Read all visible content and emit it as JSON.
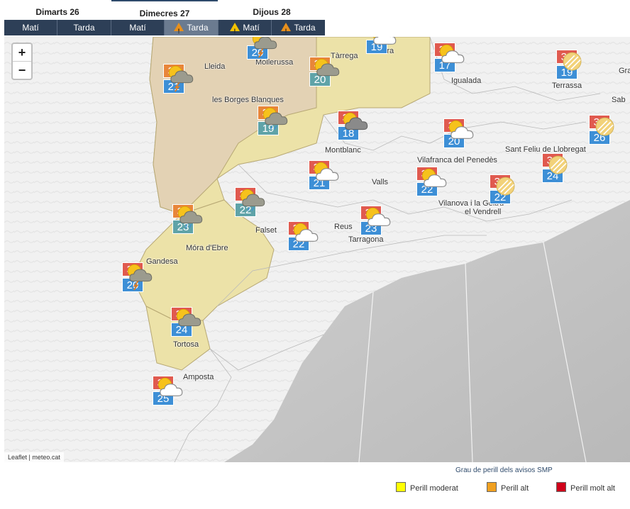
{
  "days": [
    {
      "label": "Dimarts 26"
    },
    {
      "label": "Dimecres 27"
    },
    {
      "label": "Dijous 28"
    }
  ],
  "periods": [
    {
      "label": "Matí",
      "warning": ""
    },
    {
      "label": "Tarda",
      "warning": ""
    },
    {
      "label": "Matí",
      "warning": ""
    },
    {
      "label": "Tarda",
      "warning": "orange"
    },
    {
      "label": "Matí",
      "warning": "yellow"
    },
    {
      "label": "Tarda",
      "warning": "orange"
    }
  ],
  "zoom": {
    "in": "+",
    "out": "−"
  },
  "attribution": "Leaflet | meteo.cat",
  "cities": [
    {
      "name": "Lleida"
    },
    {
      "name": "Mollerussa"
    },
    {
      "name": "Tàrrega"
    },
    {
      "name": "Cervera"
    },
    {
      "name": "Igualada"
    },
    {
      "name": "Terrassa"
    },
    {
      "name": "les Borges Blanques"
    },
    {
      "name": "Montblanc"
    },
    {
      "name": "Sant Feliu de Llobregat"
    },
    {
      "name": "Vilafranca del Penedès"
    },
    {
      "name": "Valls"
    },
    {
      "name": "Vilanova i la Geltrú"
    },
    {
      "name": "el Vendrell"
    },
    {
      "name": "Falset"
    },
    {
      "name": "Reus"
    },
    {
      "name": "Tarragona"
    },
    {
      "name": "Móra d'Ebre"
    },
    {
      "name": "Gandesa"
    },
    {
      "name": "Tortosa"
    },
    {
      "name": "Amposta"
    },
    {
      "name": "Sab"
    },
    {
      "name": "Gra"
    }
  ],
  "forecasts": [
    {
      "max": "",
      "min": "20",
      "icon": "storm"
    },
    {
      "max": "",
      "min": "19",
      "icon": "partly-cloudy"
    },
    {
      "max": "34",
      "min": "17",
      "icon": "partly-cloudy"
    },
    {
      "max": "33",
      "min": "19",
      "icon": "haze"
    },
    {
      "max": "36",
      "min": "21",
      "icon": "storm"
    },
    {
      "max": "35",
      "min": "20",
      "icon": "partly-cloudy-dark"
    },
    {
      "max": "36",
      "min": "19",
      "icon": "rain-cloud"
    },
    {
      "max": "32",
      "min": "18",
      "icon": "cloudy"
    },
    {
      "max": "33",
      "min": "20",
      "icon": "partly-cloudy"
    },
    {
      "max": "30",
      "min": "26",
      "icon": "haze"
    },
    {
      "max": "31",
      "min": "21",
      "icon": "partly-cloudy"
    },
    {
      "max": "32",
      "min": "22",
      "icon": "rain-cloud"
    },
    {
      "max": "33",
      "min": "22",
      "icon": "partly-cloudy"
    },
    {
      "max": "32",
      "min": "22",
      "icon": "haze"
    },
    {
      "max": "30",
      "min": "24",
      "icon": "haze"
    },
    {
      "max": "35",
      "min": "23",
      "icon": "rain-cloud"
    },
    {
      "max": "31",
      "min": "22",
      "icon": "partly-cloudy"
    },
    {
      "max": "30",
      "min": "23",
      "icon": "partly-cloudy"
    },
    {
      "max": "33",
      "min": "20",
      "icon": "storm"
    },
    {
      "max": "34",
      "min": "24",
      "icon": "partly-cloudy-dark"
    },
    {
      "max": "30",
      "min": "25",
      "icon": "partly-cloudy"
    }
  ],
  "legend": {
    "title": "Grau de perill dels avisos SMP",
    "items": [
      {
        "label": "Perill moderat",
        "color": "#ffff00"
      },
      {
        "label": "Perill alt",
        "color": "#f0a020"
      },
      {
        "label": "Perill molt alt",
        "color": "#d0021b"
      }
    ]
  },
  "colors": {
    "max_high": "#e8863a",
    "max_normal": "#e05a4f",
    "min_normal": "#3d8fd6",
    "min_teal": "#5fa3a8",
    "zone_yellow": "#ece2a8",
    "zone_tan": "#e3d2b4"
  }
}
